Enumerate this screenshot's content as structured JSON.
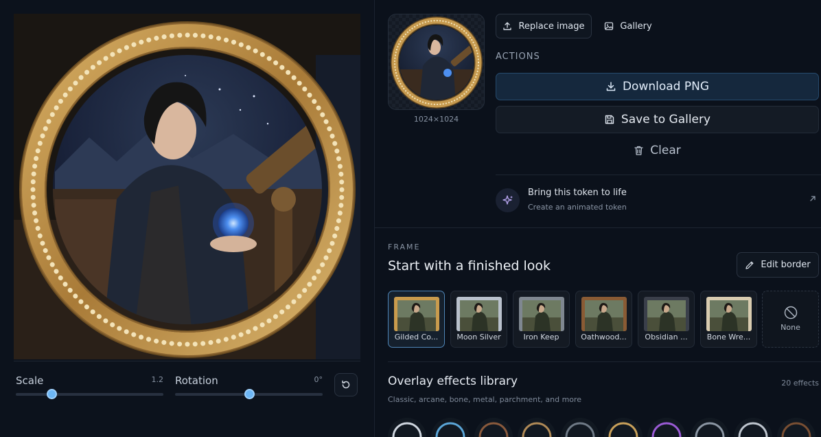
{
  "editor": {
    "scale_label": "Scale",
    "scale_value": "1.2",
    "scale_fraction": 0.24,
    "rotation_label": "Rotation",
    "rotation_value": "0°",
    "rotation_fraction": 0.5
  },
  "preview": {
    "size_text": "1024×1024"
  },
  "toolbar": {
    "replace_label": "Replace image",
    "gallery_label": "Gallery"
  },
  "actions": {
    "caption": "ACTIONS",
    "download_label": "Download PNG",
    "save_label": "Save to Gallery",
    "clear_label": "Clear"
  },
  "animate_cta": {
    "title": "Bring this token to life",
    "subtitle": "Create an animated token"
  },
  "frame": {
    "caption": "FRAME",
    "title": "Start with a finished look",
    "edit_label": "Edit border",
    "presets": [
      {
        "name": "Gilded Co...",
        "selected": true,
        "color": "#c99b4d"
      },
      {
        "name": "Moon Silver",
        "selected": false,
        "color": "#b9c1cc"
      },
      {
        "name": "Iron Keep",
        "selected": false,
        "color": "#7f8790"
      },
      {
        "name": "Oathwood...",
        "selected": false,
        "color": "#8a5b34"
      },
      {
        "name": "Obsidian ...",
        "selected": false,
        "color": "#3a3f4a"
      },
      {
        "name": "Bone Wre...",
        "selected": false,
        "color": "#d9ccb0"
      }
    ],
    "none_label": "None"
  },
  "overlays": {
    "title": "Overlay effects library",
    "subtitle": "Classic, arcane, bone, metal, parchment, and more",
    "count": "20 effects",
    "chips": [
      "#cfd6df",
      "#5ba6d8",
      "#8a5a3c",
      "#b08a57",
      "#6f7a86",
      "#c9a15a",
      "#9b5bd6",
      "#8b96a3",
      "#bfc6cf",
      "#7a4f33"
    ]
  },
  "colors": {
    "accent": "#6cb6f5",
    "gold": "#c69a4f",
    "orb": "#3f7ee8"
  }
}
